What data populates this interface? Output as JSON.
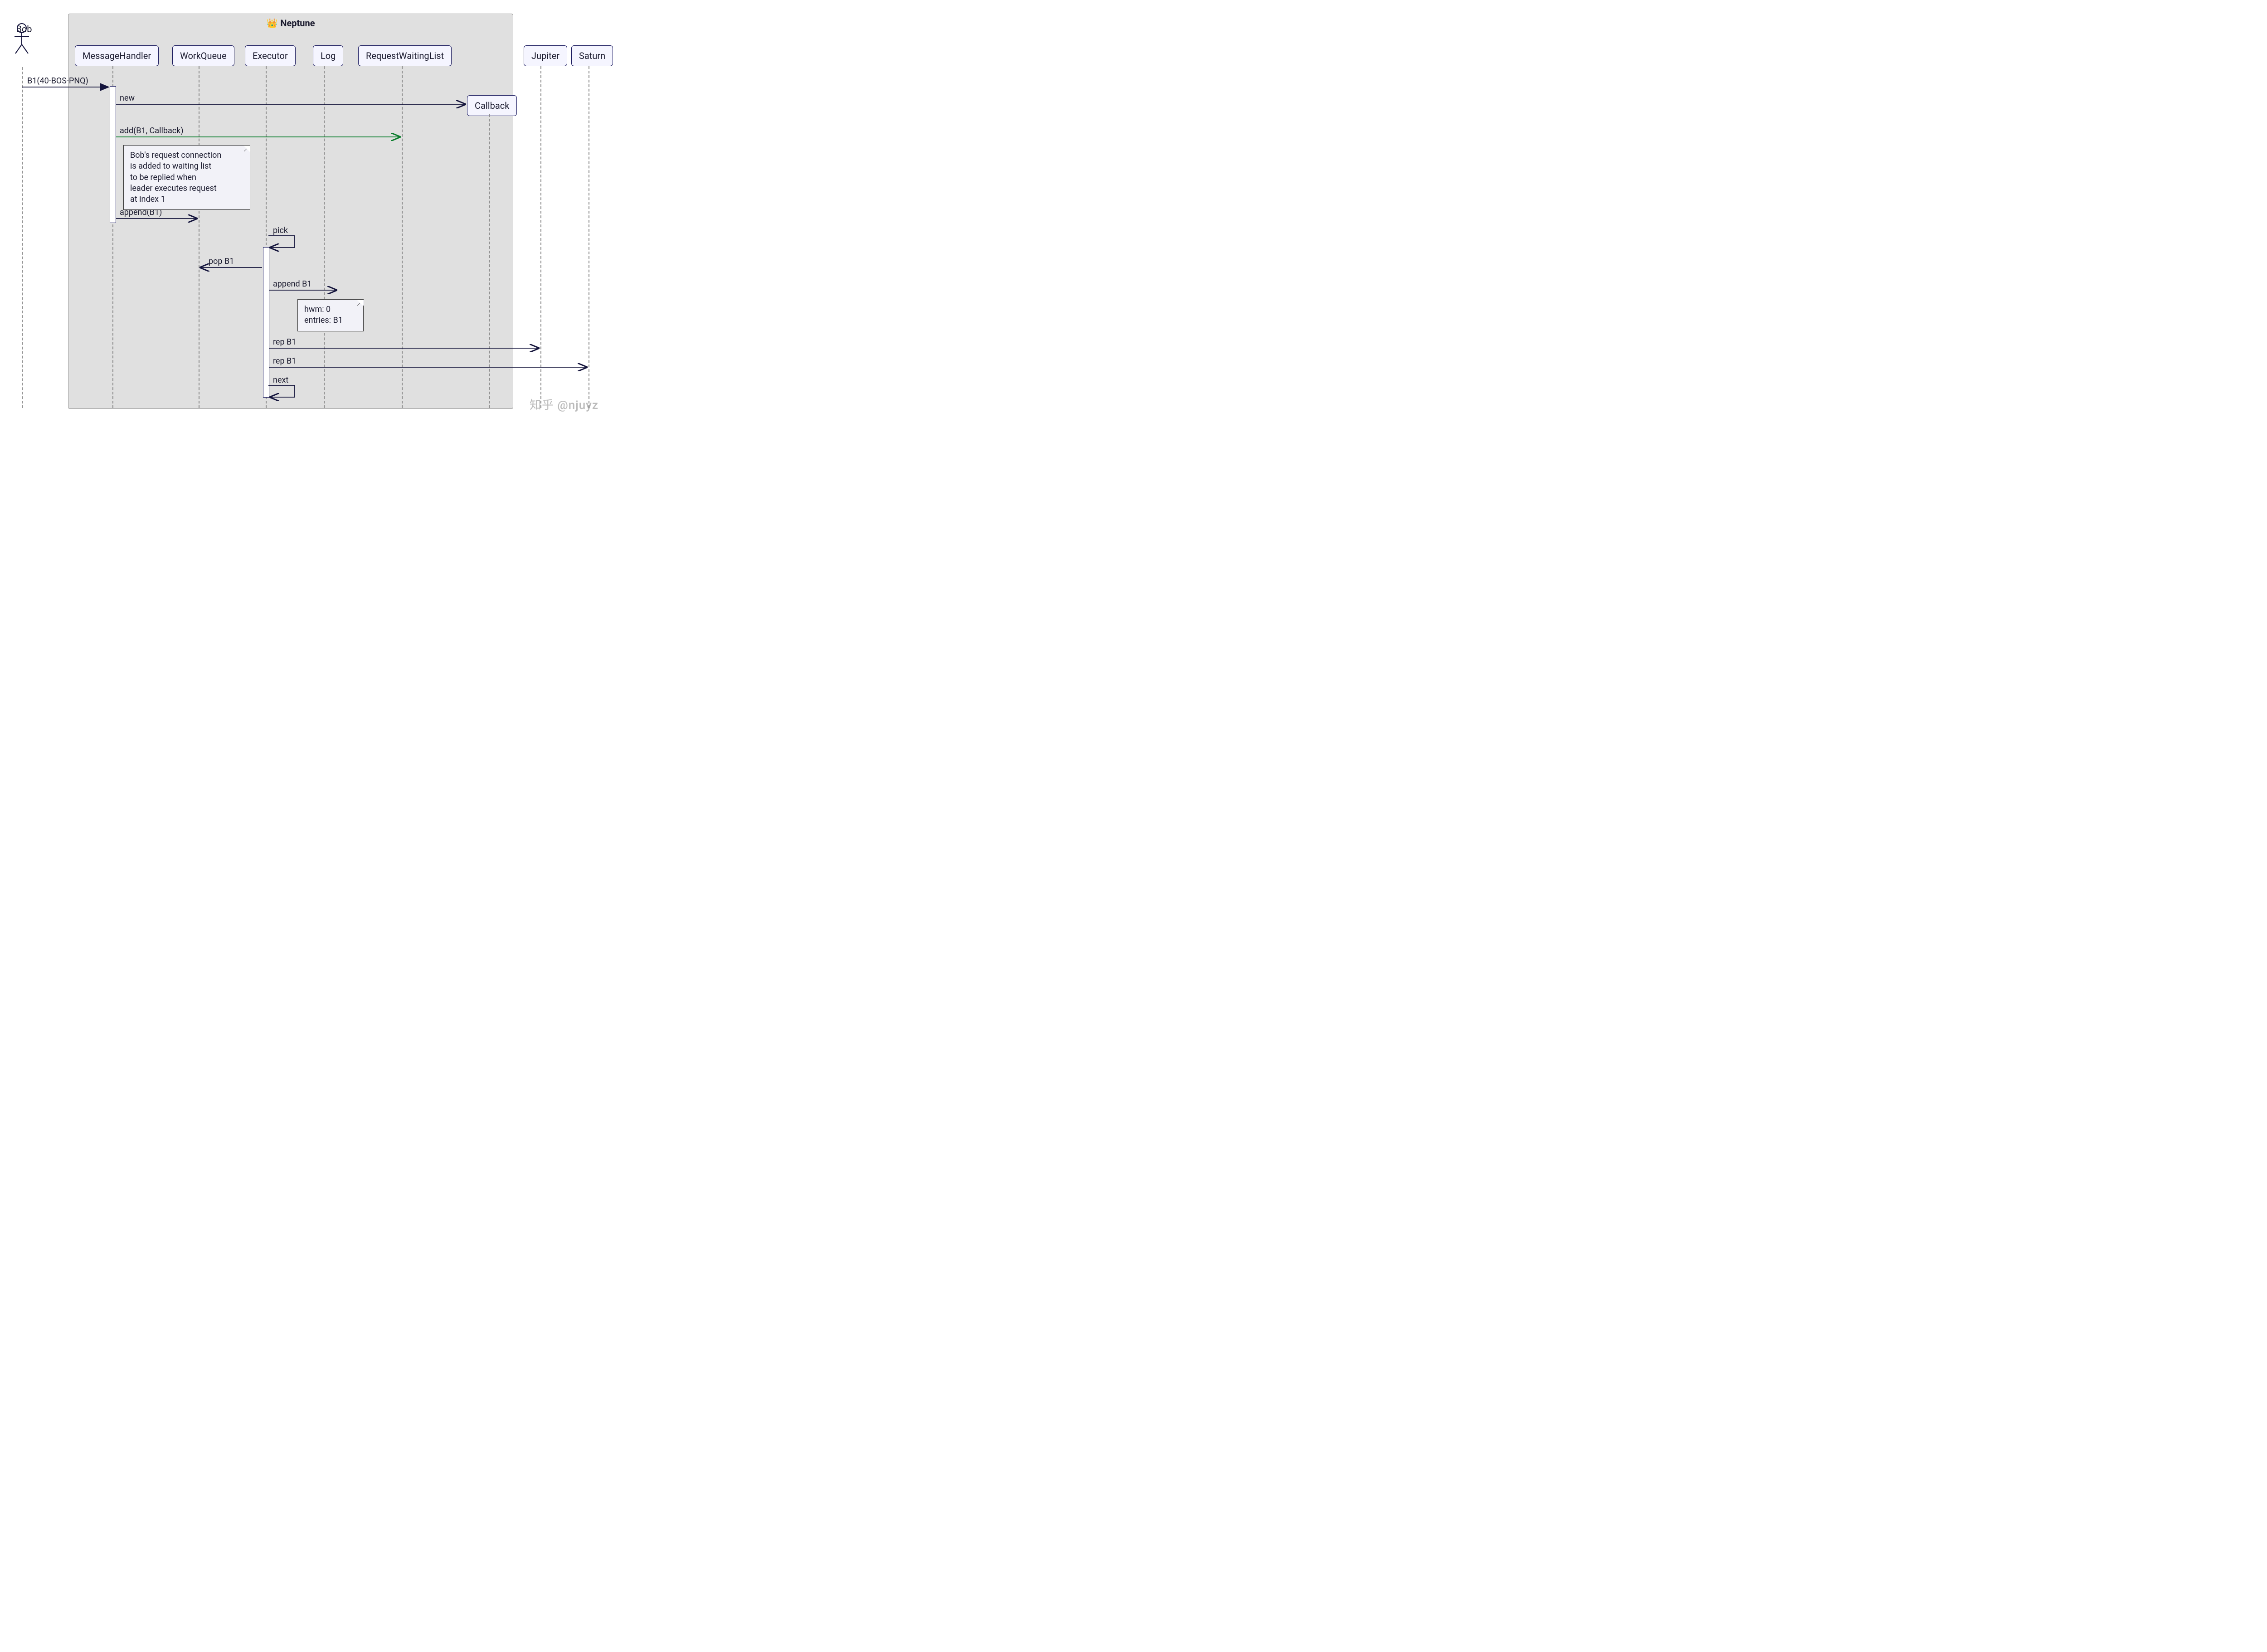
{
  "frame": {
    "title": "Neptune",
    "icon": "crown-icon"
  },
  "actor": {
    "name": "Bob"
  },
  "participants": {
    "messageHandler": "MessageHandler",
    "workQueue": "WorkQueue",
    "executor": "Executor",
    "log": "Log",
    "requestWaitingList": "RequestWaitingList",
    "callback": "Callback",
    "jupiter": "Jupiter",
    "saturn": "Saturn"
  },
  "messages": {
    "m1": "B1(40-BOS-PNQ)",
    "m2": "new",
    "m3": "add(B1, Callback)",
    "m4": "append(B1)",
    "m5": "pick",
    "m6": "pop B1",
    "m7": "append B1",
    "m8": "rep B1",
    "m9": "rep B1",
    "m10": "next"
  },
  "notes": {
    "n1": "Bob's request connection\nis added to waiting list\nto be replied when\nleader executes request\nat index 1",
    "n2": "hwm: 0\nentries: B1"
  },
  "watermark": "知乎 @njuyz",
  "colors": {
    "arrow": "#14143c",
    "green": "#0a7d2c",
    "frame": "#e0e0e0"
  }
}
